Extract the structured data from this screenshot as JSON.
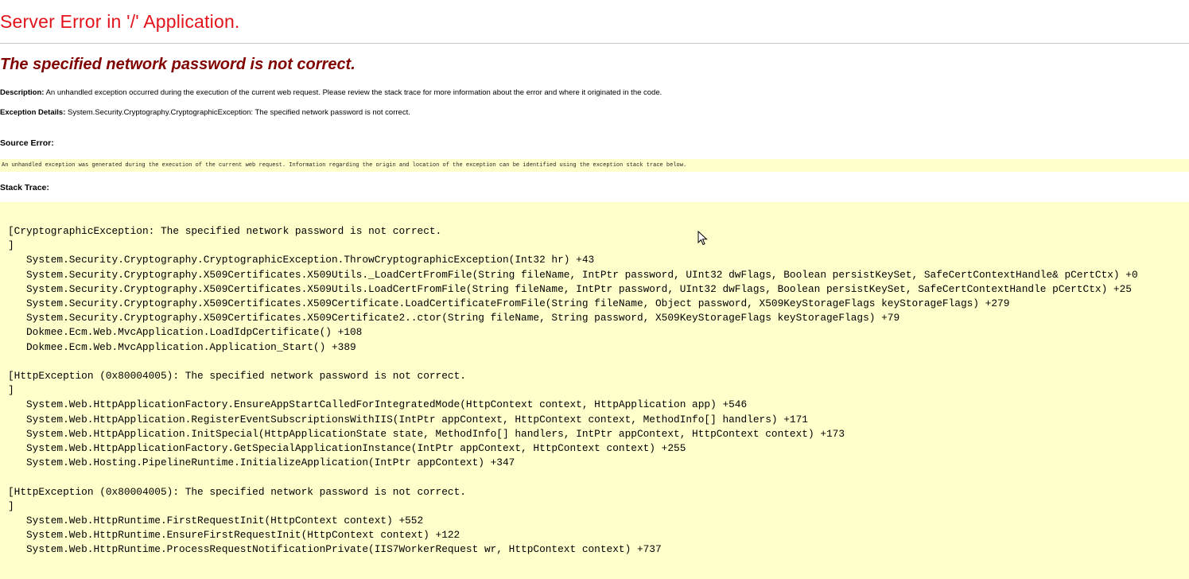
{
  "page": {
    "title": "Server Error in '/' Application.",
    "error_message": "The specified network password is not correct.",
    "description_label": "Description:",
    "description_text": "An unhandled exception occurred during the execution of the current web request. Please review the stack trace for more information about the error and where it originated in the code.",
    "exception_details_label": "Exception Details:",
    "exception_details_text": "System.Security.Cryptography.CryptographicException: The specified network password is not correct.",
    "source_error_label": "Source Error:",
    "source_error_text": "An unhandled exception was generated during the execution of the current web request. Information regarding the origin and location of the exception can be identified using the exception stack trace below.",
    "stack_trace_label": "Stack Trace:"
  },
  "stack_trace": {
    "exceptions": [
      {
        "header": "[CryptographicException: The specified network password is not correct.",
        "close": "]",
        "frames": [
          "System.Security.Cryptography.CryptographicException.ThrowCryptographicException(Int32 hr) +43",
          "System.Security.Cryptography.X509Certificates.X509Utils._LoadCertFromFile(String fileName, IntPtr password, UInt32 dwFlags, Boolean persistKeySet, SafeCertContextHandle& pCertCtx) +0",
          "System.Security.Cryptography.X509Certificates.X509Utils.LoadCertFromFile(String fileName, IntPtr password, UInt32 dwFlags, Boolean persistKeySet, SafeCertContextHandle pCertCtx) +25",
          "System.Security.Cryptography.X509Certificates.X509Certificate.LoadCertificateFromFile(String fileName, Object password, X509KeyStorageFlags keyStorageFlags) +279",
          "System.Security.Cryptography.X509Certificates.X509Certificate2..ctor(String fileName, String password, X509KeyStorageFlags keyStorageFlags) +79",
          "Dokmee.Ecm.Web.MvcApplication.LoadIdpCertificate() +108",
          "Dokmee.Ecm.Web.MvcApplication.Application_Start() +389"
        ]
      },
      {
        "header": "[HttpException (0x80004005): The specified network password is not correct.",
        "close": "]",
        "frames": [
          "System.Web.HttpApplicationFactory.EnsureAppStartCalledForIntegratedMode(HttpContext context, HttpApplication app) +546",
          "System.Web.HttpApplication.RegisterEventSubscriptionsWithIIS(IntPtr appContext, HttpContext context, MethodInfo[] handlers) +171",
          "System.Web.HttpApplication.InitSpecial(HttpApplicationState state, MethodInfo[] handlers, IntPtr appContext, HttpContext context) +173",
          "System.Web.HttpApplicationFactory.GetSpecialApplicationInstance(IntPtr appContext, HttpContext context) +255",
          "System.Web.Hosting.PipelineRuntime.InitializeApplication(IntPtr appContext) +347"
        ]
      },
      {
        "header": "[HttpException (0x80004005): The specified network password is not correct.",
        "close": "]",
        "frames": [
          "System.Web.HttpRuntime.FirstRequestInit(HttpContext context) +552",
          "System.Web.HttpRuntime.EnsureFirstRequestInit(HttpContext context) +122",
          "System.Web.HttpRuntime.ProcessRequestNotificationPrivate(IIS7WorkerRequest wr, HttpContext context) +737"
        ]
      }
    ]
  },
  "colors": {
    "title": "#e3121b",
    "error_message": "#800000",
    "code_background": "#ffffcc"
  },
  "icons": {
    "cursor": "mouse-pointer-icon"
  }
}
